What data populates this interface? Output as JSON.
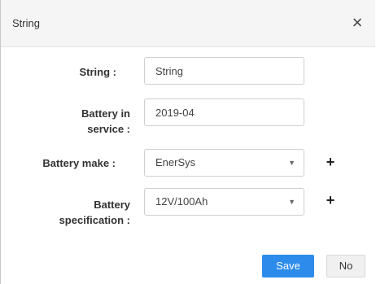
{
  "dialog": {
    "title": "String",
    "close_glyph": "×"
  },
  "form": {
    "string": {
      "label": "String :",
      "value": "String"
    },
    "battery_in_service": {
      "label_line1": "Battery in",
      "label_line2": "service :",
      "value": "2019-04"
    },
    "battery_make": {
      "label": "Battery make :",
      "value": "EnerSys",
      "add_glyph": "+"
    },
    "battery_spec": {
      "label_line1": "Battery",
      "label_line2": "specification :",
      "value": "12V/100Ah",
      "add_glyph": "+"
    }
  },
  "select_caret": "▼",
  "buttons": {
    "save": "Save",
    "no": "No"
  },
  "colors": {
    "primary": "#2d8ceb",
    "header_bg": "#f5f5f5"
  }
}
